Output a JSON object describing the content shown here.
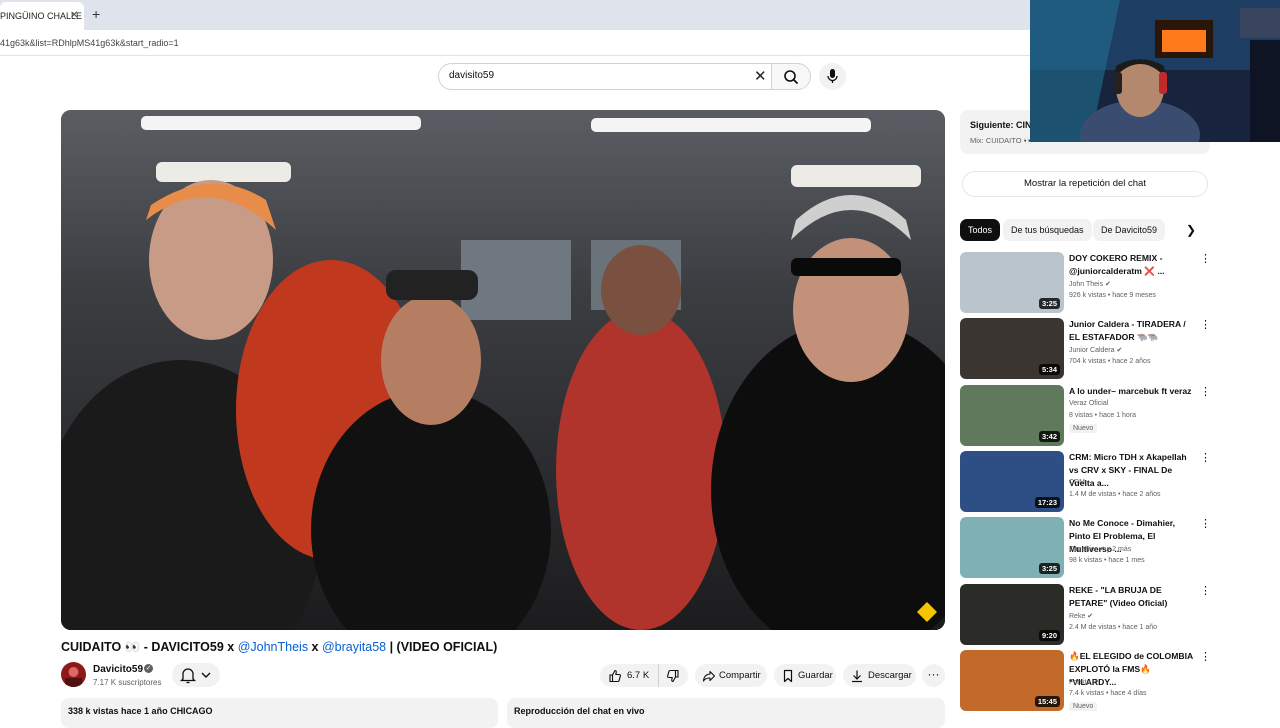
{
  "browser": {
    "tab_title": "PINGÜINO CHALLE",
    "address": "41g63k&list=RDhlpMS41g63k&start_radio=1"
  },
  "search": {
    "value": "davisito59"
  },
  "video": {
    "title_main": "CUIDAITO 👀 - DAVICITO59 x ",
    "mention_1": "@JohnTheis",
    "sep": " x ",
    "mention_2": "@brayita58",
    "title_end": " | (VIDEO OFICIAL)",
    "channel": "Davicito59",
    "subscribers": "7.17 K suscriptores",
    "likes": "6.7 K",
    "share": "Compartir",
    "save": "Guardar",
    "download": "Descargar",
    "description_summary": "338 k vistas  hace 1 año  CHICAGO",
    "chat_replay_label": "Reproducción del chat en vivo"
  },
  "sidebar": {
    "next_label": "Siguiente: CINIC",
    "next_mix": "Mix: CUIDAITO 👀",
    "chat_replay_button": "Mostrar la repetición del chat",
    "chips": [
      "Todos",
      "De tus búsquedas",
      "De Davicito59"
    ],
    "recommendations": [
      {
        "title": "DOY COKERO REMIX - @juniorcalderatm ❌ ...",
        "channel": "John Theis",
        "meta": "926 k vistas • hace 9 meses",
        "duration": "3:25",
        "badge": "",
        "thumb_color": "#b9c4cc"
      },
      {
        "title": "Junior Caldera - TIRADERA / EL ESTAFADOR 🐃🐃",
        "channel": "Junior Caldera",
        "meta": "704 k vistas • hace 2 años",
        "duration": "5:34",
        "badge": "",
        "thumb_color": "#3a3530"
      },
      {
        "title": "A lo under– marcebuk ft veraz",
        "channel": "Veraz Oficial",
        "meta": "8 vistas • hace 1 hora",
        "duration": "3:42",
        "badge": "Nuevo",
        "thumb_color": "#5f7a5a"
      },
      {
        "title": "CRM: Micro TDH x Akapellah vs CRV x SKY - FINAL De Vuelta a...",
        "channel": "CRM",
        "meta": "1.4 M de vistas • hace 2 años",
        "duration": "17:23",
        "badge": "",
        "thumb_color": "#2d4f86"
      },
      {
        "title": "No Me Conoce - Dimahier, Pinto El Problema, El Multiverso ...",
        "channel": "Dimahier",
        "meta": "98 k vistas • hace 1 mes",
        "duration": "3:25",
        "badge": "",
        "thumb_color": "#7fb1b4"
      },
      {
        "title": "REKE - \"LA BRUJA DE PETARE\" (Video Oficial)",
        "channel": "Reke",
        "meta": "2.4 M de vistas • hace 1 año",
        "duration": "9:20",
        "badge": "",
        "thumb_color": "#2b2b28"
      },
      {
        "title": "🔥EL ELEGIDO de COLOMBIA EXPLOTÓ la FMS🔥 *VILARDY...",
        "channel": "Forcito",
        "meta": "7.4 k vistas • hace 4 días",
        "duration": "15:45",
        "badge": "Nuevo",
        "thumb_color": "#c26a2a"
      }
    ],
    "channel_labels": [
      "John Theis ✔",
      "Junior Caldera ✔",
      "Veraz Oficial",
      "CRM",
      "Dimahier ✔ y 2 más",
      "Reke ✔",
      "Forcito ✔"
    ]
  },
  "icons": {
    "clear": "close-icon",
    "search": "search-icon",
    "mic": "mic-icon",
    "bell": "bell-icon",
    "like": "thumb-up-icon",
    "dislike": "thumb-down-icon",
    "share": "share-icon",
    "save": "bookmark-icon",
    "download": "download-icon",
    "more": "more-icon",
    "chevron": "chevron-right-icon"
  }
}
